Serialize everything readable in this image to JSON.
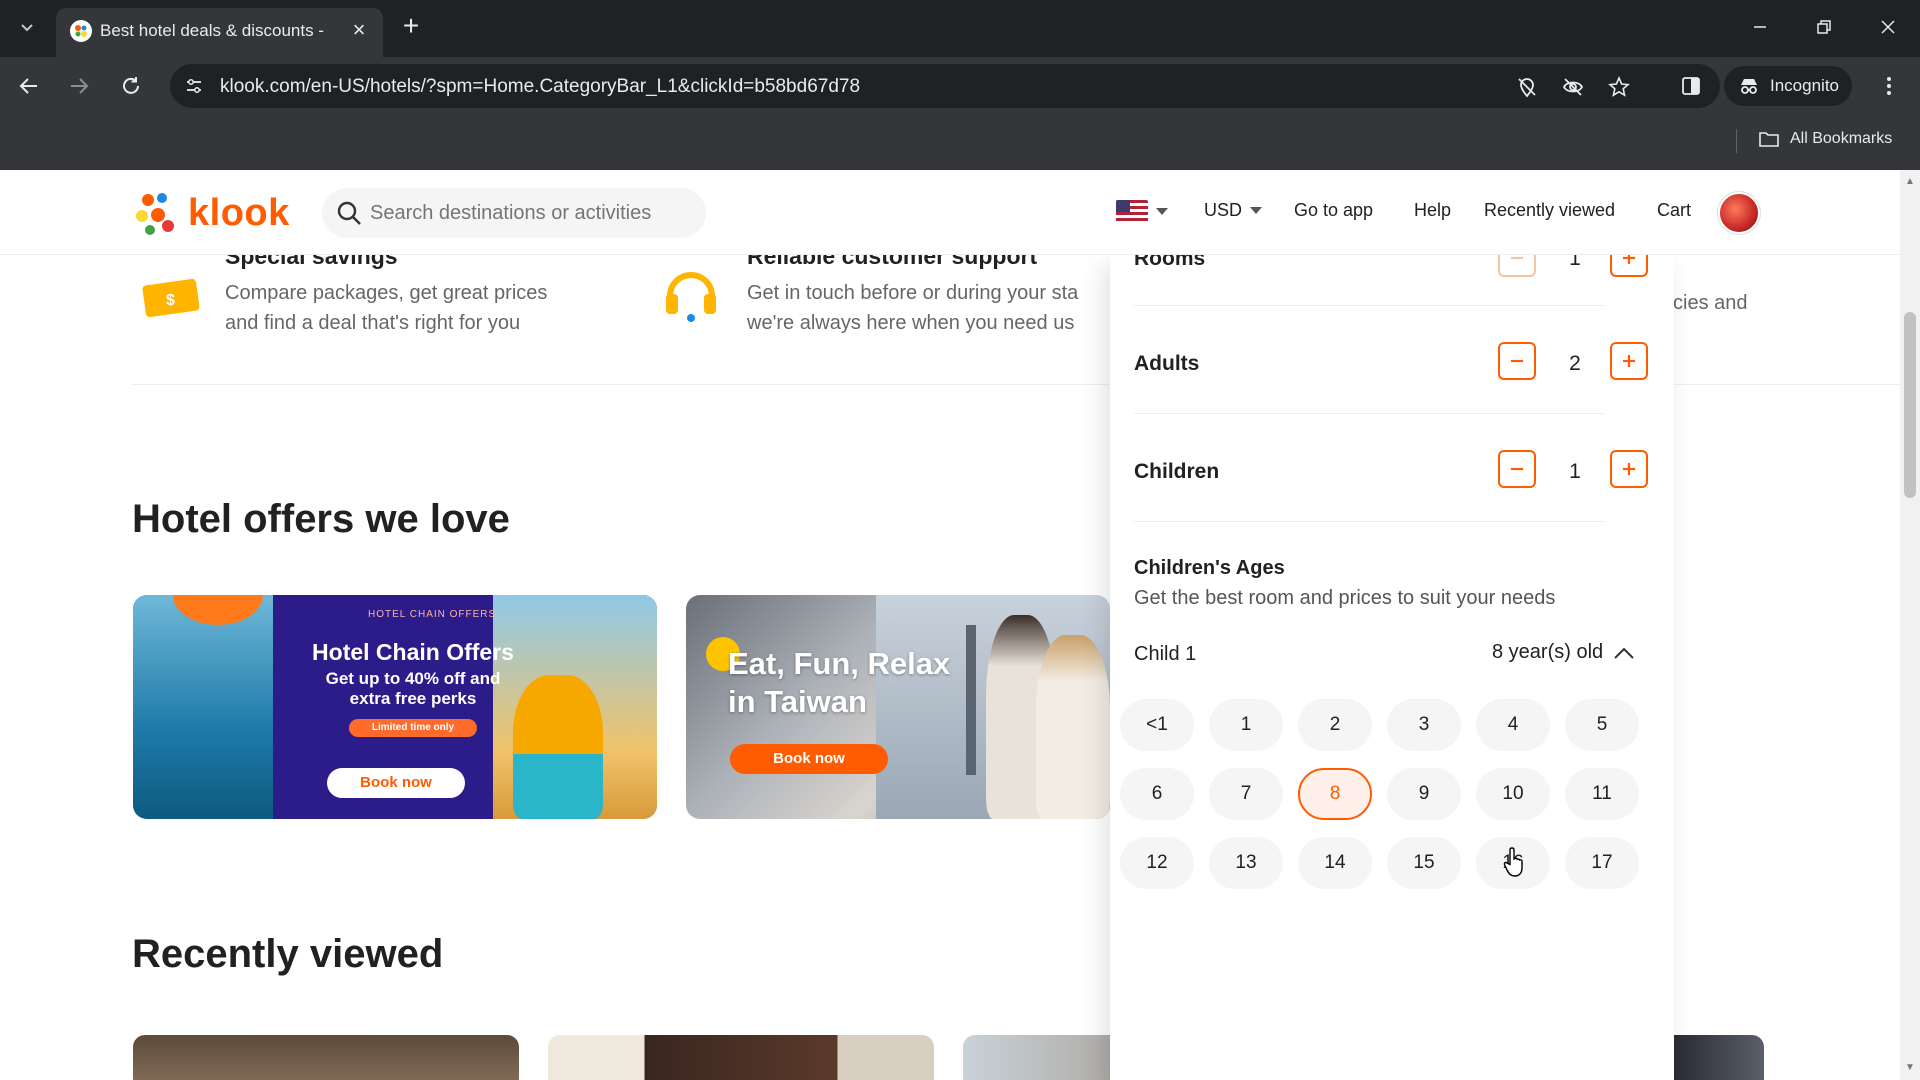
{
  "browser": {
    "tab_title": "Best hotel deals & discounts - K",
    "url": "klook.com/en-US/hotels/?spm=Home.CategoryBar_L1&clickId=b58bd67d78",
    "incognito_label": "Incognito",
    "all_bookmarks_label": "All Bookmarks"
  },
  "header": {
    "logo_text": "klook",
    "search_placeholder": "Search destinations or activities",
    "currency": "USD",
    "links": [
      "Go to app",
      "Help",
      "Recently viewed",
      "Cart"
    ]
  },
  "benefits": [
    {
      "title": "Special savings",
      "lines": [
        "Compare packages, get great prices",
        "and find a deal that's right for you"
      ]
    },
    {
      "title": "Reliable customer support",
      "lines": [
        "Get in touch before or during your sta",
        "we're always here when you need us"
      ]
    },
    {
      "partial_text": "cies and"
    }
  ],
  "sections": {
    "offers_title": "Hotel offers we love",
    "recent_title": "Recently viewed"
  },
  "offers": [
    {
      "tag": "HOTEL CHAIN OFFERS",
      "title": "Hotel Chain Offers",
      "line1": "Get up to 40% off and",
      "line2": "extra free perks",
      "pill": "Limited time only",
      "button": "Book now"
    },
    {
      "title_line1": "Eat, Fun, Relax",
      "title_line2": "in Taiwan",
      "button": "Book now"
    }
  ],
  "guest_panel": {
    "rooms_label": "Rooms",
    "rooms_value": "1",
    "adults_label": "Adults",
    "adults_value": "2",
    "children_label": "Children",
    "children_value": "1",
    "ages_title": "Children's Ages",
    "ages_subtitle": "Get the best room and prices to suit your needs",
    "child_label": "Child 1",
    "child_age_value": "8 year(s) old",
    "age_options": [
      "<1",
      "1",
      "2",
      "3",
      "4",
      "5",
      "6",
      "7",
      "8",
      "9",
      "10",
      "11",
      "12",
      "13",
      "14",
      "15",
      "16",
      "17"
    ],
    "selected_age": "8"
  },
  "colors": {
    "brand": "#ff5b00",
    "browser_dark": "#202124",
    "browser_toolbar": "#35363a"
  }
}
